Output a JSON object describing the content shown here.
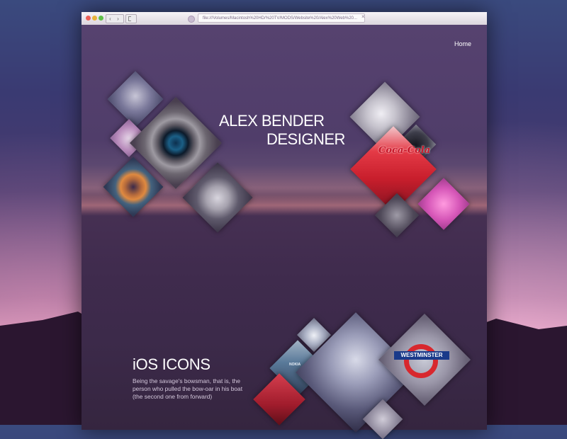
{
  "browser": {
    "url": "file:///Volumes/Macintosh%20HD/%20TV/MODS/Website%20/Alex%20Web%20..."
  },
  "nav": {
    "home_label": "Home"
  },
  "hero": {
    "title_line1": "ALEX BENDER",
    "title_line2": "DESIGNER"
  },
  "section": {
    "title": "iOS ICONS",
    "description": "Being the savage's bowsman, that is, the person who pulled the bow-oar in his boat (the second one from forward)"
  },
  "tiles": {
    "left_cluster": [
      "lunchbox-icon",
      "pink-container-icon",
      "camera-icon",
      "washing-machine-icon",
      "stove-icon"
    ],
    "right_cluster": [
      "sink-icon",
      "speaker-icon",
      "coca-cola-fridge-icon",
      "pink-device-icon",
      "lock-icon"
    ],
    "bottom_cluster": [
      "gauge-icon",
      "nokia-phone-icon",
      "lunchbox-large-icon",
      "westminster-sign-icon",
      "coca-cola-fridge-small-icon",
      "metal-tube-icon"
    ],
    "coca_cola_label": "Coca-Cola",
    "westminster_label": "WESTMINSTER",
    "nokia_label": "NOKIA"
  }
}
